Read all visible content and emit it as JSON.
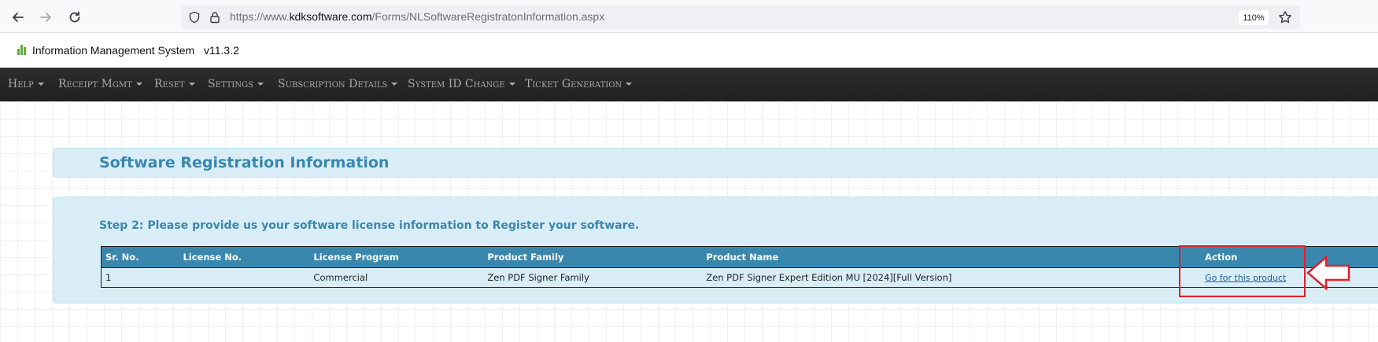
{
  "browser": {
    "url_prefix": "https://www.",
    "url_domain": "kdksoftware.com",
    "url_path": "/Forms/NLSoftwareRegistratonInformation.aspx",
    "zoom": "110%",
    "icons": [
      "back-arrow-icon",
      "forward-arrow-icon",
      "reload-icon",
      "shield-icon",
      "lock-icon",
      "star-icon"
    ]
  },
  "app": {
    "title": "Information Management System",
    "version": "v11.3.2",
    "logo_color": "#5cab3b"
  },
  "menu": {
    "items": [
      {
        "label": "Help"
      },
      {
        "label": "Receipt Mgmt"
      },
      {
        "label": "Reset"
      },
      {
        "label": "Settings"
      },
      {
        "label": "Subscription Details"
      },
      {
        "label": "System ID Change"
      },
      {
        "label": "Ticket Generation"
      }
    ]
  },
  "page": {
    "title": "Software Registration Information",
    "step": "Step 2: Please provide us your software license information to Register your software."
  },
  "table": {
    "headers": [
      "Sr. No.",
      "License No.",
      "License Program",
      "Product Family",
      "Product Name",
      "Action"
    ],
    "rows": [
      {
        "sr_no": "1",
        "license_no": "",
        "license_program": "Commercial",
        "product_family": "Zen PDF Signer Family",
        "product_name": "Zen PDF Signer Expert Edition MU [2024][Full Version]",
        "action": "Go for this product"
      }
    ]
  },
  "colors": {
    "accent": "#3a87ad",
    "panel_bg": "#d9edf7",
    "menubar_bg": "#262626",
    "annotation": "#e0202a"
  }
}
